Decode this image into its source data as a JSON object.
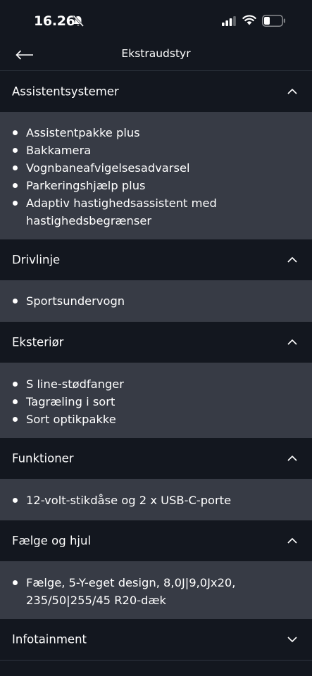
{
  "status_bar": {
    "time": "16.26"
  },
  "header": {
    "title": "Ekstraudstyr"
  },
  "sections": [
    {
      "title": "Assistentsystemer",
      "expanded": true,
      "items": [
        "Assistentpakke plus",
        "Bakkamera",
        "Vognbaneafvigelsesadvarsel",
        "Parkeringshjælp plus",
        "Adaptiv hastighedsassistent med hastighedsbegrænser"
      ]
    },
    {
      "title": "Drivlinje",
      "expanded": true,
      "items": [
        "Sportsundervogn"
      ]
    },
    {
      "title": "Eksteriør",
      "expanded": true,
      "items": [
        "S line-stødfanger",
        "Tagræling i sort",
        "Sort optikpakke"
      ]
    },
    {
      "title": "Funktioner",
      "expanded": true,
      "items": [
        "12-volt-stikdåse og 2 x USB-C-porte"
      ]
    },
    {
      "title": "Fælge og hjul",
      "expanded": true,
      "items": [
        "Fælge, 5-Y-eget design, 8,0J|9,0Jx20, 235/50|255/45 R20-dæk"
      ]
    },
    {
      "title": "Infotainment",
      "expanded": false,
      "items": []
    }
  ],
  "icons": {
    "back": "arrow-left-icon",
    "expanded": "chevron-up-icon",
    "collapsed": "chevron-down-icon"
  },
  "colors": {
    "background": "#13171f",
    "section_body": "#373b45",
    "text": "#ffffff"
  }
}
